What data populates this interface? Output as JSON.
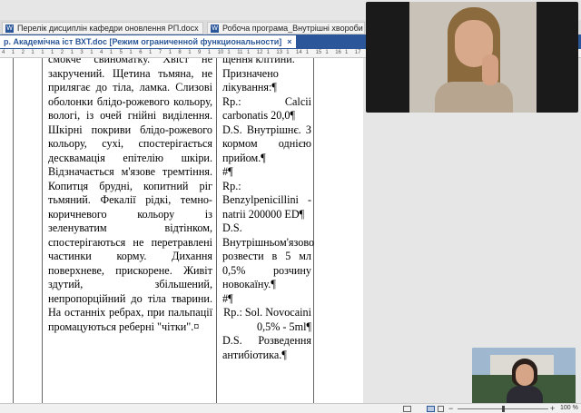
{
  "tabs": [
    {
      "label": "Перелік дисциплін кафедри оновлення РП.docx",
      "icon": "word-icon"
    },
    {
      "label": "Робоча програма_Внутрішні хвороби",
      "icon": "word-icon"
    }
  ],
  "title_bar": {
    "document_title": "р. Академічна іст ВХТ.doc [Режим ограниченной функциональности]",
    "close_symbol": "×"
  },
  "ruler_ticks": [
    "4",
    "1",
    "2",
    "1",
    "1",
    "1",
    "2",
    "1",
    "3",
    "1",
    "4",
    "1",
    "5",
    "1",
    "6",
    "1",
    "7",
    "1",
    "8",
    "1",
    "9",
    "1",
    "10",
    "1",
    "11",
    "1",
    "12",
    "1",
    "13",
    "1",
    "14",
    "1",
    "15",
    "1",
    "16",
    "1",
    "17"
  ],
  "document": {
    "left_column": [
      "смокче свиноматку. Хвіст не закручений. Щетина тьмяна, не прилягає до тіла, ламка. Слизові оболонки блідо-рожевого кольору, вологі, із очей гнійні виділення. Шкірні покриви блідо-рожевого кольору, сухі, спостерігається десквамація епітелію шкіри. Відзначається м'язове тремтіння. Копитця брудні, копитний ріг тьмяний. Фекалії рідкі, темно-коричневого кольору із зеленуватим відтінком, спостерігаються не перетравлені частинки корму. Дихання поверхневе, прискорене. Живіт здутий, збільшений, непропорційний до тіла тварини. На останніх ребрах, при пальпації промацуються реберні \"чітки\".¤"
    ],
    "right_column": [
      {
        "text": "щення клітини.",
        "align": "left"
      },
      {
        "text": "Призначено лікування:¶",
        "align": "left"
      },
      {
        "text": "Rp.: Calcii carbonatis 20,0¶",
        "align": "justify"
      },
      {
        "text": "D.S. Внутрішнє. З кормом однією прийом.¶",
        "align": "justify"
      },
      {
        "text": "#¶",
        "align": "left"
      },
      {
        "text": "Rp.: Benzylpenicillini - natrii 200000 ED¶",
        "align": "justify"
      },
      {
        "text": "D.S. Внутрішньом'язово розвести в 5 мл 0,5% розчину новокаїну.¶",
        "align": "justify"
      },
      {
        "text": "#¶",
        "align": "left"
      },
      {
        "text": "Rp.: Sol. Novocaini 0,5% - 5ml¶",
        "align": "right"
      },
      {
        "text": "D.S. Розведення антибіотика.¶",
        "align": "justify"
      }
    ]
  },
  "video_feeds": {
    "main": "participant-video-main",
    "small": "participant-video-small"
  },
  "status_bar": {
    "zoom_level": "100 %",
    "zoom_fraction": 0.5,
    "zoom_minus": "−",
    "zoom_plus": "+"
  },
  "colors": {
    "word_blue": "#2b579a",
    "page_background": "#ffffff"
  }
}
